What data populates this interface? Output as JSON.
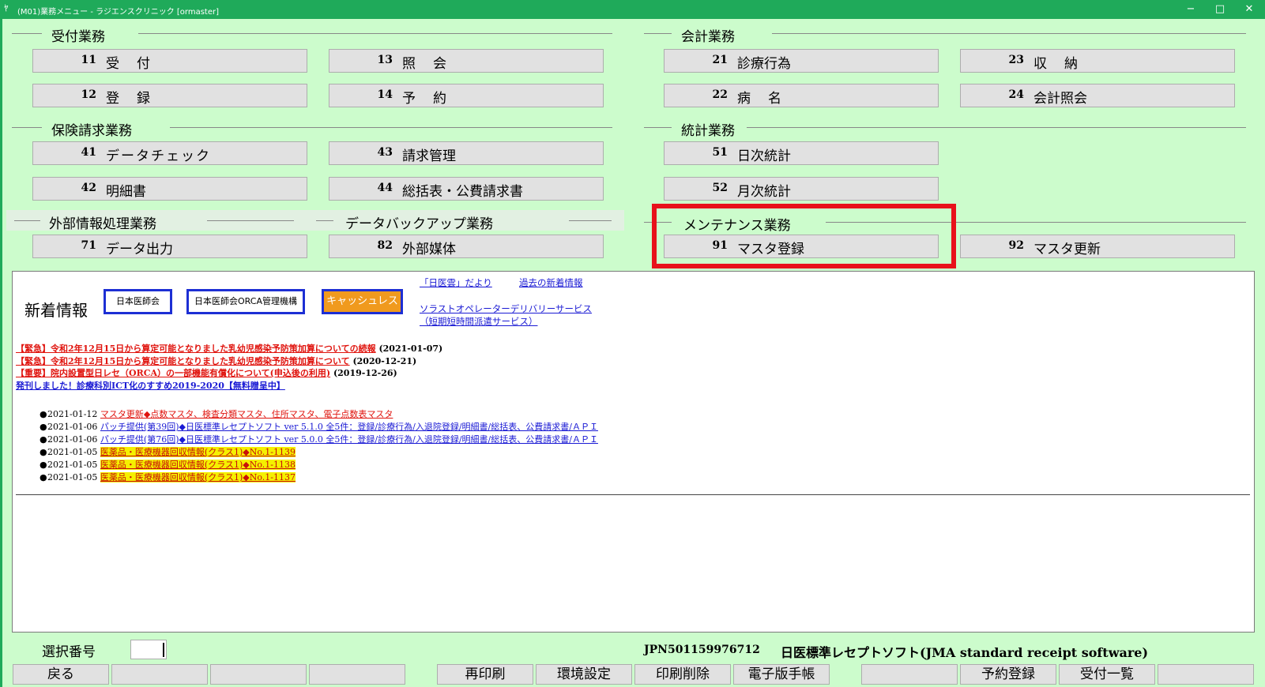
{
  "window": {
    "title": "(M01)業務メニュー - ラジエンスクリニック [ormaster]",
    "app_icon": "orca-app-icon",
    "minimize_glyph": "−",
    "maximize_glyph": "□",
    "close_glyph": "✕"
  },
  "sections": {
    "uketsuke": "受付業務",
    "kaikei": "会計業務",
    "hoken": "保険請求業務",
    "toukei": "統計業務",
    "gaibu": "外部情報処理業務",
    "backup": "データバックアップ業務",
    "maintenance": "メンテナンス業務"
  },
  "menu": {
    "b11": {
      "num": "11",
      "label": "受付"
    },
    "b13": {
      "num": "13",
      "label": "照会"
    },
    "b21": {
      "num": "21",
      "label": "診療行為"
    },
    "b23": {
      "num": "23",
      "label": "収納"
    },
    "b12": {
      "num": "12",
      "label": "登録"
    },
    "b14": {
      "num": "14",
      "label": "予約"
    },
    "b22": {
      "num": "22",
      "label": "病名"
    },
    "b24": {
      "num": "24",
      "label": "会計照会"
    },
    "b41": {
      "num": "41",
      "label": "データチェック"
    },
    "b43": {
      "num": "43",
      "label": "請求管理"
    },
    "b51": {
      "num": "51",
      "label": "日次統計"
    },
    "b42": {
      "num": "42",
      "label": "明細書"
    },
    "b44": {
      "num": "44",
      "label": "総括表・公費請求書"
    },
    "b52": {
      "num": "52",
      "label": "月次統計"
    },
    "b71": {
      "num": "71",
      "label": "データ出力"
    },
    "b82": {
      "num": "82",
      "label": "外部媒体"
    },
    "b91": {
      "num": "91",
      "label": "マスタ登録"
    },
    "b92": {
      "num": "92",
      "label": "マスタ更新"
    }
  },
  "news": {
    "title": "新着情報",
    "logo_jma": "日本医師会",
    "logo_orca": "日本医師会ORCA管理機構",
    "logo_cashless": "キャッシュレス",
    "link_dayori": "「日医雲」だより",
    "link_past": "過去の新着情報",
    "link_operator": "ソラストオペレーターデリバリーサービス",
    "link_operator2": "（短期短時間派遣サービス）",
    "alerts": [
      {
        "text": "【緊急】令和2年12月15日から算定可能となりました乳幼児感染予防策加算についての続報",
        "date": "(2021-01-07)"
      },
      {
        "text": "【緊急】令和2年12月15日から算定可能となりました乳幼児感染予防策加算について",
        "date": "(2020-12-21)"
      },
      {
        "text": "【重要】院内設置型日レセ（ORCA）の一部機能有償化について(申込後の利用)",
        "date": "(2019-12-26)"
      },
      {
        "text": "発刊しました！診療科別ICT化のすすめ2019-2020【無料贈呈中】",
        "date": ""
      }
    ],
    "items": [
      {
        "date": "2021-01-12",
        "text": "マスタ更新◆点数マスタ、検査分類マスタ、住所マスタ、電子点数表マスタ"
      },
      {
        "date": "2021-01-06",
        "text": "パッチ提供(第39回)◆日医標準レセプトソフト ver 5.1.0 全5件：登録/診療行為/入退院登録/明細書/総括表、公費請求書/ＡＰＩ"
      },
      {
        "date": "2021-01-06",
        "text": "パッチ提供(第76回)◆日医標準レセプトソフト ver 5.0.0 全5件：登録/診療行為/入退院登録/明細書/総括表、公費請求書/ＡＰＩ"
      },
      {
        "date": "2021-01-05",
        "text": "医薬品・医療機器回収情報(クラス1)◆No.1-1139"
      },
      {
        "date": "2021-01-05",
        "text": "医薬品・医療機器回収情報(クラス1)◆No.1-1138"
      },
      {
        "date": "2021-01-05",
        "text": "医薬品・医療機器回収情報(クラス1)◆No.1-1137"
      }
    ]
  },
  "bottom": {
    "select_label": "選択番号",
    "select_value": "",
    "license_id": "JPN501159976712",
    "software_name": "日医標準レセプトソフト(JMA standard receipt software)"
  },
  "fkeys": {
    "f1": "戻る",
    "f2": "",
    "f3": "",
    "f4": "",
    "f5": "再印刷",
    "f6": "環境設定",
    "f7": "印刷削除",
    "f8": "電子版手帳",
    "f9": "",
    "f10": "予約登録",
    "f11": "受付一覧",
    "f12": ""
  },
  "colors": {
    "background": "#ccfccc",
    "titlebar": "#1faa5a",
    "highlight": "#e8111b",
    "link_red": "#e0140e",
    "link_blue": "#1a1ad4",
    "yellow": "#f5f000"
  }
}
